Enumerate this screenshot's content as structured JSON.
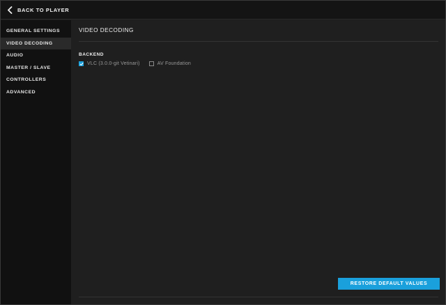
{
  "topbar": {
    "back_icon": "chevron-left-icon",
    "back_label": "BACK TO PLAYER"
  },
  "sidebar": {
    "items": [
      {
        "label": "GENERAL SETTINGS",
        "active": false
      },
      {
        "label": "VIDEO DECODING",
        "active": true
      },
      {
        "label": "AUDIO",
        "active": false
      },
      {
        "label": "MASTER / SLAVE",
        "active": false
      },
      {
        "label": "CONTROLLERS",
        "active": false
      },
      {
        "label": "ADVANCED",
        "active": false
      }
    ]
  },
  "main": {
    "title": "VIDEO DECODING",
    "backend": {
      "label": "BACKEND",
      "options": [
        {
          "label": "VLC (3.0.0-git Vetinari)",
          "checked": true
        },
        {
          "label": "AV Foundation",
          "checked": false
        }
      ]
    },
    "restore_label": "RESTORE DEFAULT VALUES"
  },
  "colors": {
    "accent": "#1aa0dc",
    "background": "#1f1f1f",
    "sidebar": "#111111"
  }
}
